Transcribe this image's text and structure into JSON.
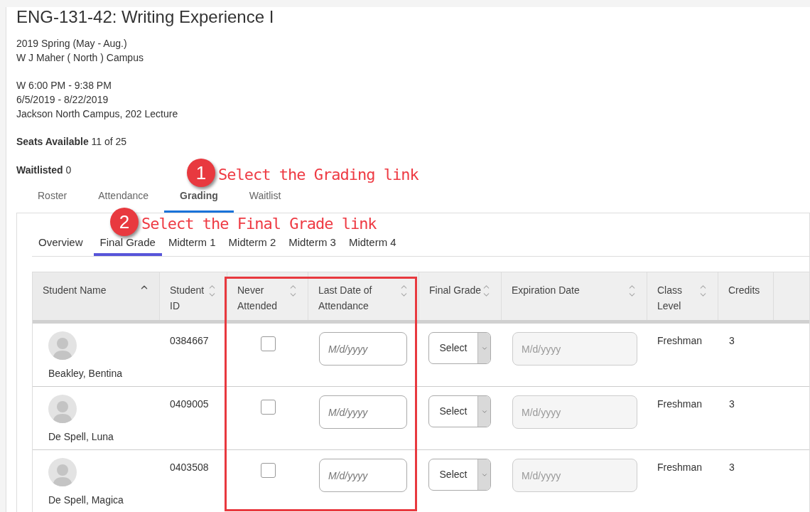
{
  "course": {
    "title": "ENG-131-42: Writing Experience I",
    "term": "2019 Spring (May - Aug.)",
    "campus": "W J Maher ( North ) Campus",
    "schedule": "W 6:00 PM - 9:38 PM",
    "dates": "6/5/2019 - 8/22/2019",
    "location": "Jackson North Campus, 202 Lecture"
  },
  "seats": {
    "label": "Seats Available",
    "value": "11 of 25"
  },
  "waitlisted": {
    "label": "Waitlisted",
    "value": "0"
  },
  "tabs": [
    {
      "label": "Roster",
      "selected": false
    },
    {
      "label": "Attendance",
      "selected": false
    },
    {
      "label": "Grading",
      "selected": true
    },
    {
      "label": "Waitlist",
      "selected": false
    }
  ],
  "subtabs": [
    {
      "label": "Overview",
      "selected": false
    },
    {
      "label": "Final Grade",
      "selected": true
    },
    {
      "label": "Midterm 1",
      "selected": false
    },
    {
      "label": "Midterm 2",
      "selected": false
    },
    {
      "label": "Midterm 3",
      "selected": false
    },
    {
      "label": "Midterm 4",
      "selected": false
    }
  ],
  "table": {
    "columns": [
      {
        "label": "Student Name",
        "sortable": true,
        "sorted": true
      },
      {
        "label": "Student ID",
        "sortable": true,
        "sorted": false
      },
      {
        "label": "Never Attended",
        "sortable": true,
        "sorted": false
      },
      {
        "label": "Last Date of Attendance",
        "sortable": true,
        "sorted": false
      },
      {
        "label": "Final Grade",
        "sortable": true,
        "sorted": false
      },
      {
        "label": "Expiration Date",
        "sortable": true,
        "sorted": false
      },
      {
        "label": "Class Level",
        "sortable": true,
        "sorted": false
      },
      {
        "label": "Credits",
        "sortable": false
      }
    ],
    "rows": [
      {
        "name": "Beakley, Bentina",
        "id": "0384667",
        "never_attended": false,
        "last_date_placeholder": "M/d/yyyy",
        "final_grade": "Select",
        "expiration_placeholder": "M/d/yyyy",
        "class_level": "Freshman",
        "credits": "3"
      },
      {
        "name": "De Spell, Luna",
        "id": "0409005",
        "never_attended": false,
        "last_date_placeholder": "M/d/yyyy",
        "final_grade": "Select",
        "expiration_placeholder": "M/d/yyyy",
        "class_level": "Freshman",
        "credits": "3"
      },
      {
        "name": "De Spell, Magica",
        "id": "0403508",
        "never_attended": false,
        "last_date_placeholder": "M/d/yyyy",
        "final_grade": "Select",
        "expiration_placeholder": "M/d/yyyy",
        "class_level": "Freshman",
        "credits": "3"
      }
    ]
  },
  "annotations": [
    {
      "number": "1",
      "text": "Select the Grading link"
    },
    {
      "number": "2",
      "text": "Select the Final Grade link"
    }
  ]
}
